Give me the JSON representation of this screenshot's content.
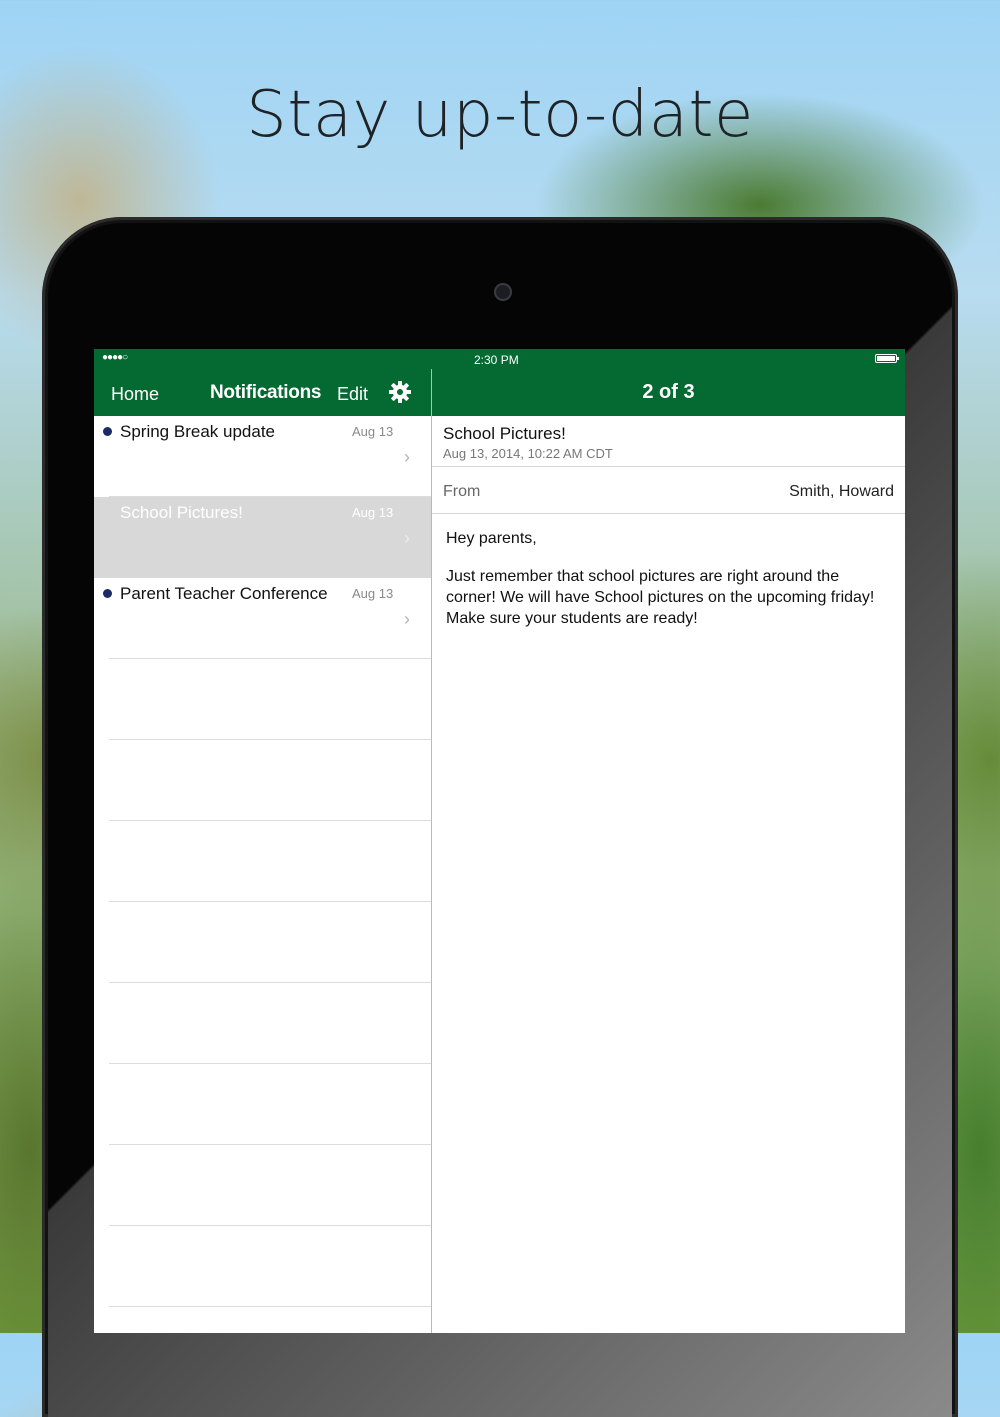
{
  "headline": "Stay up-to-date",
  "status_bar": {
    "signal": "●●●●○",
    "time": "2:30 PM"
  },
  "nav": {
    "home": "Home",
    "title": "Notifications",
    "edit": "Edit",
    "settings_icon": "gear-icon",
    "pager": "2 of 3"
  },
  "notifications": [
    {
      "title": "Spring Break update",
      "date": "Aug 13",
      "unread": true,
      "selected": false
    },
    {
      "title": "School Pictures!",
      "date": "Aug 13",
      "unread": false,
      "selected": true
    },
    {
      "title": "Parent Teacher Conference",
      "date": "Aug 13",
      "unread": true,
      "selected": false
    }
  ],
  "message": {
    "subject": "School Pictures!",
    "date": "Aug 13, 2014, 10:22 AM CDT",
    "from_label": "From",
    "from_value": "Smith, Howard",
    "greeting": "Hey parents,",
    "body": "Just remember that school pictures are right around the corner! We will have School pictures on the upcoming friday! Make sure your students are ready!"
  },
  "colors": {
    "brand_green": "#056932",
    "unread_dot": "#1c2b63",
    "selected_row": "#d8d8d8"
  }
}
